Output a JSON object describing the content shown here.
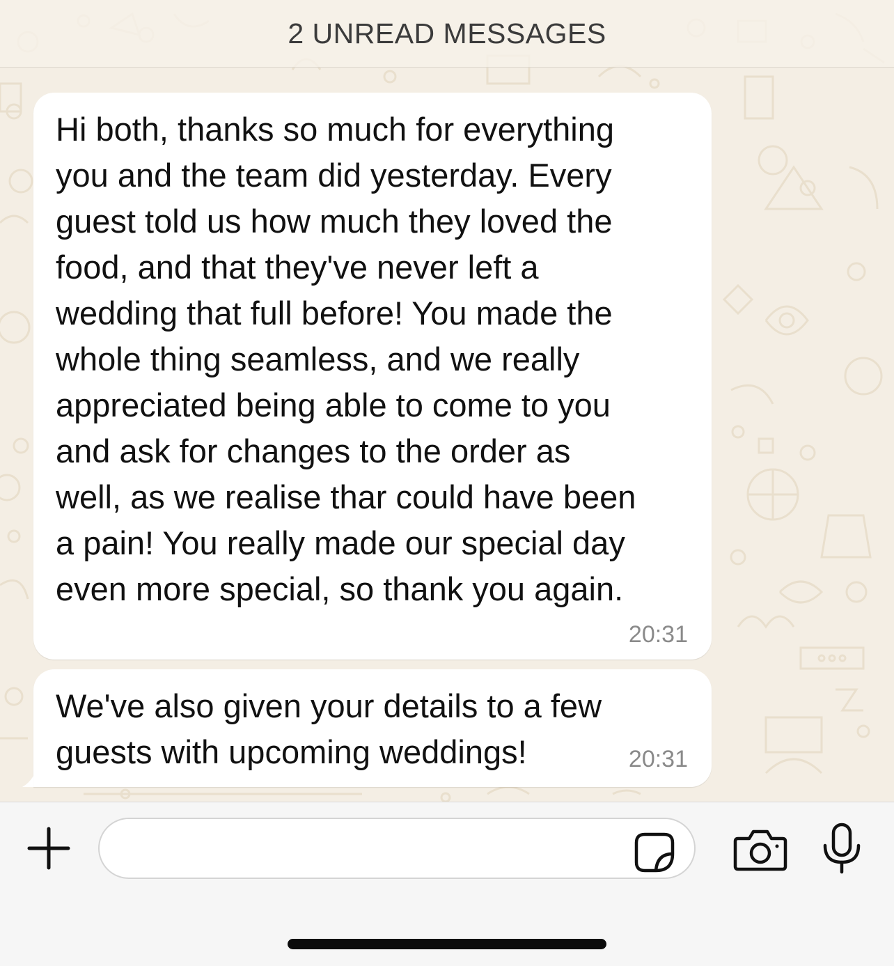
{
  "unread_banner": {
    "label": "2 UNREAD MESSAGES"
  },
  "messages": [
    {
      "text": "Hi both, thanks so much for everything\nyou and the team did yesterday.  Every\nguest told us how much they loved the\nfood, and that they've never left a\nwedding that full before! You made the\nwhole thing seamless, and we really\nappreciated being able to come to you\nand ask for changes to the order as\nwell, as we realise thar could have been\na pain! You really made our special day\neven more special, so thank you again.",
      "time": "20:31"
    },
    {
      "text": "We've also given your details to a few\nguests with upcoming weddings!",
      "time": "20:31"
    }
  ],
  "input_bar": {
    "message_value": "",
    "icons": {
      "plus": "plus-icon",
      "sticker": "sticker-icon",
      "camera": "camera-icon",
      "mic": "microphone-icon"
    }
  },
  "colors": {
    "chat_background": "#f4eee4",
    "bubble": "#ffffff",
    "timestamp": "#8a8a8a",
    "input_bar": "#f6f6f6"
  }
}
